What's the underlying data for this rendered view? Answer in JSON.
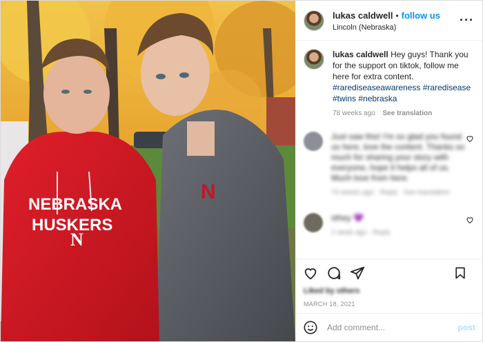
{
  "header": {
    "username": "lukas caldwell",
    "separator": "•",
    "follow_label": "follow us",
    "location": "Lincoln (Nebraska)",
    "more_label": "···"
  },
  "photo": {
    "sweatshirt_text_line1": "NEBRASKA",
    "sweatshirt_text_line2": "HUSKERS",
    "logo_letter": "N",
    "jacket_logo_letter": "N"
  },
  "caption": {
    "username": "lukas caldwell",
    "text": "Hey guys! Thank you for the support on tiktok, follow me here for extra content.",
    "hashtags": [
      "#rarediseaseawareness",
      "#raredisease",
      "#twins",
      "#nebraska"
    ],
    "age": "78 weeks ago",
    "translate_label": "See translation"
  },
  "comments": [
    {
      "blurred_text": "Just saw this! I'm so glad you found us here, love the content. Thanks so much for sharing your story with everyone, hope it helps all of us. Much love from here.",
      "blurred_meta": "74 weeks ago · Reply · See translation",
      "avatar_color": "#8a8f98"
    },
    {
      "blurred_text": "sthey 💜",
      "blurred_meta": "1 week ago · Reply",
      "avatar_color": "#6f6a5e"
    }
  ],
  "likes_blurred": "Liked by others",
  "date": "MARCH 18, 2021",
  "add_comment": {
    "placeholder": "Add comment...",
    "post_label": "post"
  },
  "icons": [
    "heart-icon",
    "comment-icon",
    "share-icon",
    "bookmark-icon",
    "emoji-icon"
  ]
}
